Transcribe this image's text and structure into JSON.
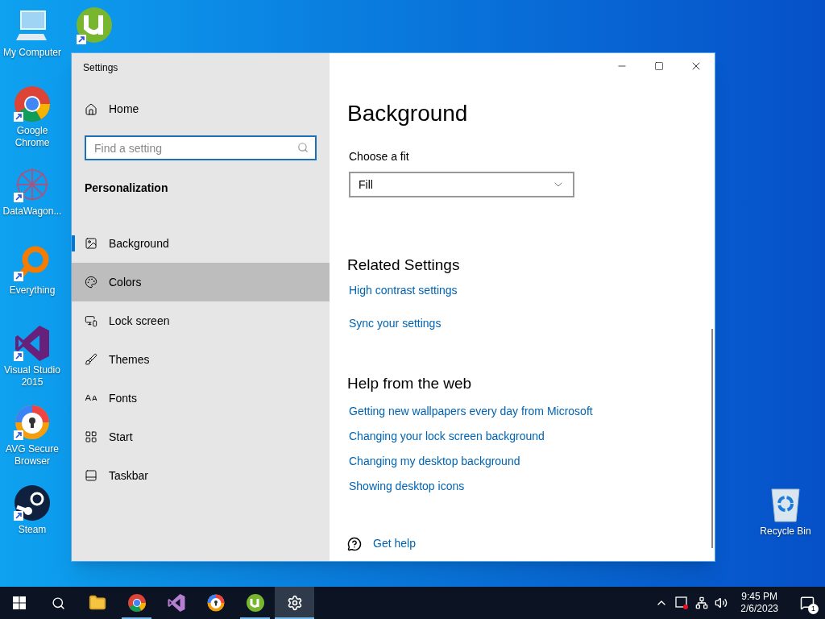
{
  "desktop_icons": [
    {
      "label": "My Computer",
      "kind": "computer"
    },
    {
      "label": "Google Chrome",
      "kind": "chrome"
    },
    {
      "label": "DataWagon...",
      "kind": "datawagon"
    },
    {
      "label": "Everything",
      "kind": "everything"
    },
    {
      "label": "Visual Studio 2015",
      "kind": "vs"
    },
    {
      "label": "AVG Secure Browser",
      "kind": "avg"
    },
    {
      "label": "Steam",
      "kind": "steam"
    },
    {
      "label": "Recycle Bin",
      "kind": "recycle"
    }
  ],
  "window": {
    "title": "Settings",
    "sidebar": {
      "home": "Home",
      "search": {
        "placeholder": "Find a setting"
      },
      "section": "Personalization",
      "items": [
        {
          "label": "Background",
          "kind": "background",
          "selected": true,
          "hovered": false
        },
        {
          "label": "Colors",
          "kind": "colors",
          "selected": false,
          "hovered": true
        },
        {
          "label": "Lock screen",
          "kind": "lock",
          "selected": false,
          "hovered": false
        },
        {
          "label": "Themes",
          "kind": "themes",
          "selected": false,
          "hovered": false
        },
        {
          "label": "Fonts",
          "kind": "fonts",
          "selected": false,
          "hovered": false
        },
        {
          "label": "Start",
          "kind": "start",
          "selected": false,
          "hovered": false
        },
        {
          "label": "Taskbar",
          "kind": "taskbar",
          "selected": false,
          "hovered": false
        }
      ]
    },
    "content": {
      "title": "Background",
      "fit_label": "Choose a fit",
      "fit_value": "Fill",
      "related": {
        "title": "Related Settings",
        "links": [
          "High contrast settings",
          "Sync your settings"
        ]
      },
      "help": {
        "title": "Help from the web",
        "links": [
          "Getting new wallpapers every day from Microsoft",
          "Changing your lock screen background",
          "Changing my desktop background",
          "Showing desktop icons"
        ]
      },
      "get_help": "Get help"
    }
  },
  "taskbar": {
    "apps": [
      {
        "kind": "explorer",
        "running": false,
        "selected": false
      },
      {
        "kind": "chrome",
        "running": true,
        "selected": false
      },
      {
        "kind": "vs",
        "running": false,
        "selected": false
      },
      {
        "kind": "avg",
        "running": false,
        "selected": false
      },
      {
        "kind": "utorrent",
        "running": true,
        "selected": false
      },
      {
        "kind": "settings",
        "running": true,
        "selected": true
      }
    ],
    "time": "9:45 PM",
    "date": "2/6/2023",
    "notifications": "1"
  }
}
